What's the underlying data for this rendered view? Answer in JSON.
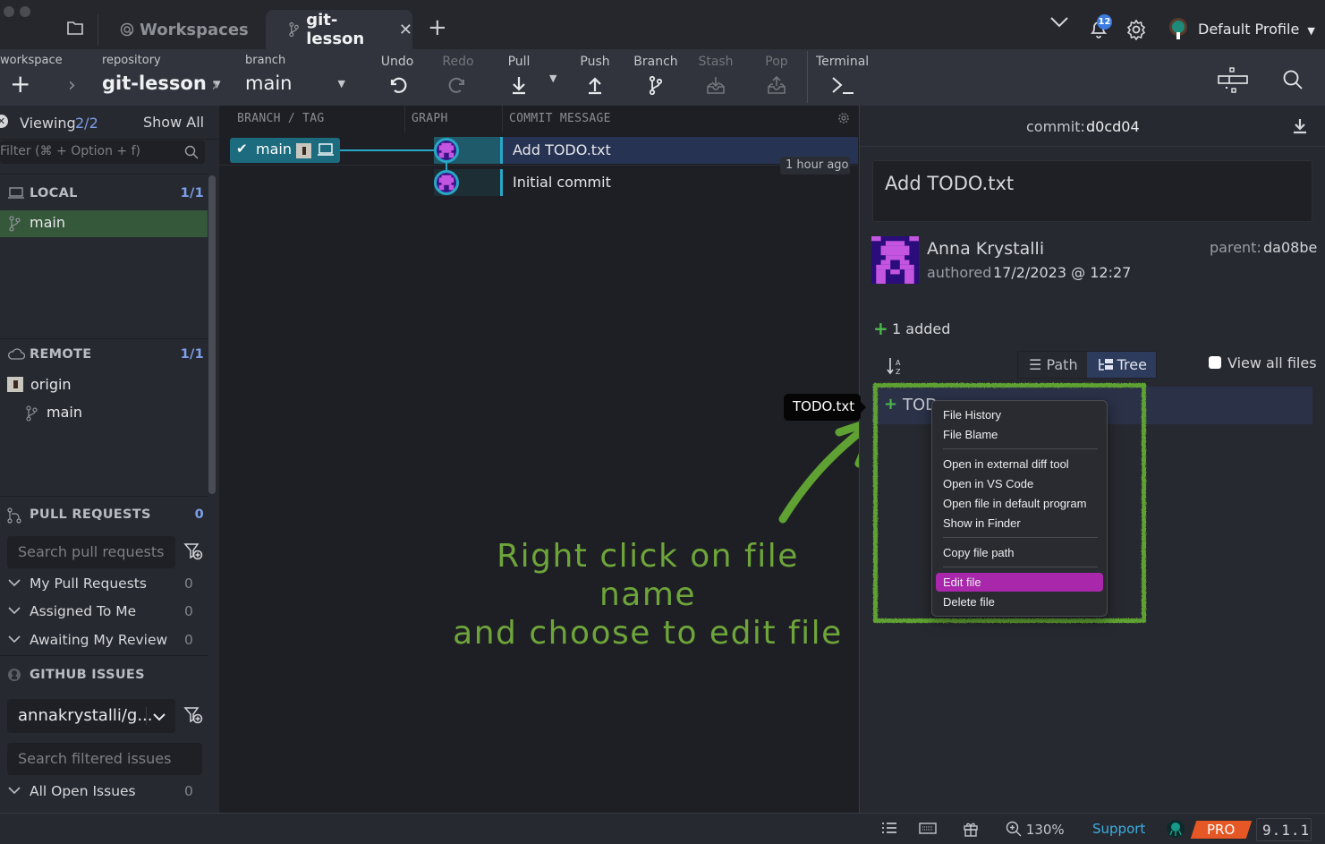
{
  "tabbar": {
    "workspaces_label": "Workspaces",
    "active_tab_label": "git-lesson",
    "notification_count": "12",
    "profile_name": "Default Profile"
  },
  "toolbar": {
    "workspace_label": "workspace",
    "repository_label": "repository",
    "repository_value": "git-lesson",
    "branch_label": "branch",
    "branch_value": "main",
    "actions": [
      {
        "label": "Undo",
        "icon": "undo-icon",
        "enabled": true
      },
      {
        "label": "Redo",
        "icon": "redo-icon",
        "enabled": false
      },
      {
        "label": "Pull",
        "icon": "pull-icon",
        "enabled": true
      },
      {
        "label": "Push",
        "icon": "push-icon",
        "enabled": true
      },
      {
        "label": "Branch",
        "icon": "branch-icon",
        "enabled": true
      },
      {
        "label": "Stash",
        "icon": "stash-icon",
        "enabled": false
      },
      {
        "label": "Pop",
        "icon": "pop-icon",
        "enabled": false
      },
      {
        "label": "Terminal",
        "icon": "terminal-icon",
        "enabled": true
      }
    ]
  },
  "sidebar": {
    "viewing_label": "Viewing",
    "viewing_value": "2/2",
    "show_all": "Show All",
    "filter_placeholder": "Filter (⌘ + Option + f)",
    "local": {
      "title": "LOCAL",
      "count": "1/1",
      "branches": [
        "main"
      ]
    },
    "remote": {
      "title": "REMOTE",
      "count": "1/1",
      "remotes": [
        {
          "name": "origin",
          "branches": [
            "main"
          ]
        }
      ]
    },
    "pull_requests": {
      "title": "PULL REQUESTS",
      "count": "0",
      "search_placeholder": "Search pull requests",
      "groups": [
        {
          "label": "My Pull Requests",
          "count": "0"
        },
        {
          "label": "Assigned To Me",
          "count": "0"
        },
        {
          "label": "Awaiting My Review",
          "count": "0"
        }
      ]
    },
    "github_issues": {
      "title": "GITHUB ISSUES",
      "repo_select": "annakrystalli/g...",
      "search_placeholder": "Search filtered issues",
      "groups": [
        {
          "label": "All Open Issues",
          "count": "0"
        }
      ]
    }
  },
  "graph": {
    "columns": [
      "BRANCH / TAG",
      "GRAPH",
      "COMMIT MESSAGE"
    ],
    "commits": [
      {
        "message": "Add TODO.txt",
        "branch": "main",
        "time": "1 hour ago",
        "selected": true
      },
      {
        "message": "Initial commit",
        "branch": "",
        "time": "",
        "selected": false
      }
    ]
  },
  "annotation": {
    "line1": "Right click on file name",
    "line2": "and choose to edit file",
    "color": "#6ea53a"
  },
  "tooltip": "TODO.txt",
  "detail": {
    "commit_label": "commit:",
    "commit_sha": "d0cd04",
    "message": "Add TODO.txt",
    "author": "Anna Krystalli",
    "authored_label": "authored",
    "authored_date": "17/2/2023 @ 12:27",
    "parent_label": "parent:",
    "parent_sha": "da08be",
    "added_summary": "1 added",
    "view_path": "Path",
    "view_tree": "Tree",
    "view_all_files": "View all files",
    "file_name_truncated": "TOD"
  },
  "context_menu": {
    "items": [
      {
        "label": "File History"
      },
      {
        "label": "File Blame"
      },
      {
        "label": "Open in external diff tool"
      },
      {
        "label": "Open in VS Code"
      },
      {
        "label": "Open file in default program"
      },
      {
        "label": "Show in Finder"
      },
      {
        "label": "Copy file path"
      },
      {
        "label": "Edit file",
        "highlighted": true
      },
      {
        "label": "Delete file"
      }
    ],
    "highlight_color": "#a827aa"
  },
  "statusbar": {
    "zoom": "130%",
    "support": "Support",
    "pro": "PRO",
    "version": "9.1.1"
  }
}
